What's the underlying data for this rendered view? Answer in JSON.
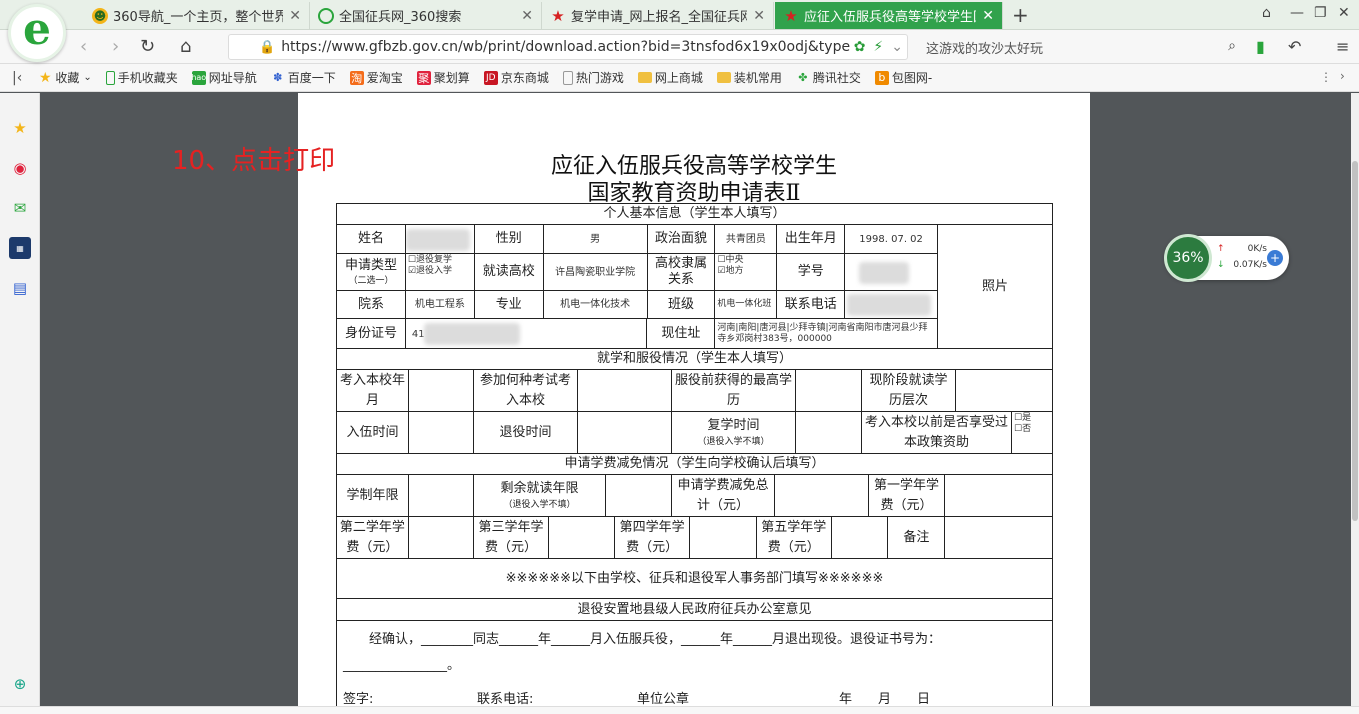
{
  "browser": {
    "tabs": [
      {
        "title": "360导航_一个主页，整个世界",
        "icon": "360-nav-icon",
        "color": "#f3b519",
        "active": false
      },
      {
        "title": "全国征兵网_360搜索",
        "icon": "360-search-icon",
        "color": "#2aa53c",
        "active": false
      },
      {
        "title": "复学申请_网上报名_全国征兵网",
        "icon": "red-star-icon",
        "color": "#d62222",
        "active": false
      },
      {
        "title": "应征入伍服兵役高等学校学生国",
        "icon": "red-star-icon",
        "color": "#d62222",
        "active": true
      }
    ],
    "url": "https://www.gfbzb.gov.cn/wb/print/download.action?bid=3tnsfod6x19x0odj&type=",
    "search_text": "这游戏的攻沙太好玩",
    "accent": "#31a24c"
  },
  "bookmarks": [
    {
      "label": "收藏",
      "icon": "star-icon",
      "color": "#f3b519"
    },
    {
      "label": "手机收藏夹",
      "icon": "phone-icon",
      "color": "#2aa53c"
    },
    {
      "label": "网址导航",
      "icon": "hao-icon",
      "color": "#2aa53c"
    },
    {
      "label": "百度一下",
      "icon": "baidu-paw-icon",
      "color": "#2f5fd0"
    },
    {
      "label": "爱淘宝",
      "icon": "taobao-icon",
      "color": "#f46c1b"
    },
    {
      "label": "聚划算",
      "icon": "juhuasuan-icon",
      "color": "#e0223d"
    },
    {
      "label": "京东商城",
      "icon": "jd-icon",
      "color": "#c81623"
    },
    {
      "label": "热门游戏",
      "icon": "page-icon",
      "color": "#888888"
    },
    {
      "label": "网上商城",
      "icon": "folder-icon",
      "color": "#f0c040"
    },
    {
      "label": "装机常用",
      "icon": "folder-icon",
      "color": "#f0c040"
    },
    {
      "label": "腾讯社交",
      "icon": "tencent-icon",
      "color": "#2aa53c"
    },
    {
      "label": "包图网-",
      "icon": "baotu-icon",
      "color": "#f08a00"
    }
  ],
  "annotation": "10、点击打印",
  "document": {
    "title_line1": "应征入伍服兵役高等学校学生",
    "title_line2": "国家教育资助申请表Ⅱ",
    "sec_basic": "个人基本信息（学生本人填写）",
    "lbl_name": "姓名",
    "lbl_gender": "性别",
    "val_gender": "男",
    "lbl_political": "政治面貌",
    "val_political": "共青团员",
    "lbl_birth": "出生年月",
    "val_birth": "1998. 07. 02",
    "lbl_photo": "照片",
    "lbl_apply_type": "申请类型",
    "lbl_apply_type_note": "（二选一）",
    "opt_resume": "☐退役复学",
    "opt_enroll": "☑退役入学",
    "lbl_school": "就读高校",
    "val_school": "许昌陶瓷职业学院",
    "lbl_affiliation": "高校隶属关系",
    "opt_central": "☐中央",
    "opt_local": "☑地方",
    "lbl_student_no": "学号",
    "lbl_dept": "院系",
    "val_dept": "机电工程系",
    "lbl_major": "专业",
    "val_major": "机电一体化技术",
    "lbl_class": "班级",
    "val_class": "机电一体化班",
    "lbl_phone": "联系电话",
    "lbl_id": "身份证号",
    "val_id_prefix": "41",
    "lbl_address": "现住址",
    "val_address": "河南|南阳|唐河县|少拜寺镇|河南省南阳市唐河县少拜寺乡邓岗村383号，000000",
    "sec_study": "就学和服役情况（学生本人填写）",
    "lbl_admit_month": "考入本校年月",
    "lbl_exam_type": "参加何种考试考入本校",
    "lbl_pre_edu": "服役前获得的最高学历",
    "lbl_cur_level": "现阶段就读学历层次",
    "lbl_enlist": "入伍时间",
    "lbl_discharge": "退役时间",
    "lbl_resume_time": "复学时间",
    "lbl_resume_note": "（退役入学不填）",
    "lbl_enjoyed": "考入本校以前是否享受过本政策资助",
    "opt_yes": "☐是",
    "opt_no": "☐否",
    "sec_fee": "申请学费减免情况（学生向学校确认后填写）",
    "lbl_duration": "学制年限",
    "lbl_remaining": "剩余就读年限",
    "lbl_remaining_note": "（退役入学不填）",
    "lbl_total": "申请学费减免总计（元）",
    "lbl_y1": "第一学年学费（元）",
    "lbl_y2": "第二学年学费（元）",
    "lbl_y3": "第三学年学费（元）",
    "lbl_y4": "第四学年学费（元）",
    "lbl_y5": "第五学年学费（元）",
    "lbl_remark": "备注",
    "sec_official": "※※※※※※以下由学校、征兵和退役军人事务部门填写※※※※※※",
    "sec_office": "退役安置地县级人民政府征兵办公室意见",
    "confirm_text": "经确认，________同志______年______月入伍服兵役，______年______月退出现役。退役证书号为：________________。",
    "sig_sign": "签字:",
    "sig_phone": "联系电话:",
    "sig_seal": "单位公章",
    "sig_date": "年　　月　　日"
  },
  "speed_widget": {
    "percent": "36%",
    "up": "0K/s",
    "down": "0.07K/s"
  }
}
